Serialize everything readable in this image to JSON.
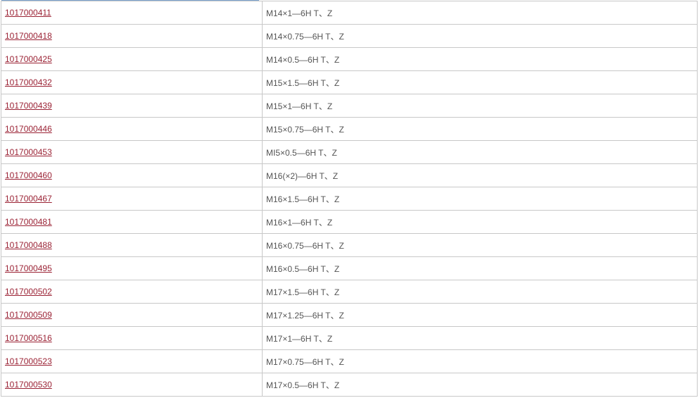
{
  "rows": [
    {
      "code": "1017000411",
      "spec": "M14×1—6H T、Z"
    },
    {
      "code": "1017000418",
      "spec": "M14×0.75—6H T、Z"
    },
    {
      "code": "1017000425",
      "spec": "M14×0.5—6H T、Z"
    },
    {
      "code": "1017000432",
      "spec": "M15×1.5—6H T、Z"
    },
    {
      "code": "1017000439",
      "spec": "M15×1—6H T、Z"
    },
    {
      "code": "1017000446",
      "spec": "M15×0.75—6H T、Z"
    },
    {
      "code": "1017000453",
      "spec": "MI5×0.5—6H T、Z"
    },
    {
      "code": "1017000460",
      "spec": "M16(×2)—6H T、Z"
    },
    {
      "code": "1017000467",
      "spec": "M16×1.5—6H T、Z"
    },
    {
      "code": "1017000481",
      "spec": "M16×1—6H T、Z"
    },
    {
      "code": "1017000488",
      "spec": "M16×0.75—6H T、Z"
    },
    {
      "code": "1017000495",
      "spec": "M16×0.5—6H T、Z"
    },
    {
      "code": "1017000502",
      "spec": "M17×1.5—6H T、Z"
    },
    {
      "code": "1017000509",
      "spec": "M17×1.25—6H T、Z"
    },
    {
      "code": "1017000516",
      "spec": "M17×1—6H T、Z"
    },
    {
      "code": "1017000523",
      "spec": "M17×0.75—6H T、Z"
    },
    {
      "code": "1017000530",
      "spec": "M17×0.5—6H T、Z"
    }
  ],
  "colors": {
    "link": "#9b2335",
    "text": "#555555",
    "border": "#c8c8c8",
    "accent": "#7aa2cf"
  }
}
